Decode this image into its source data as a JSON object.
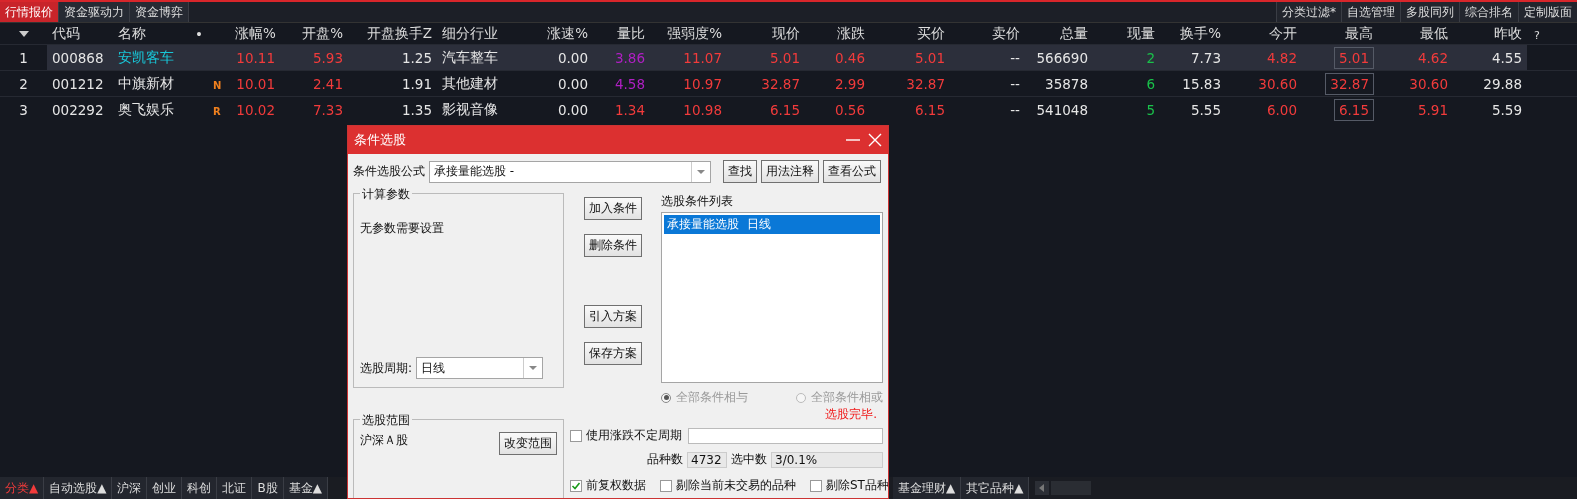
{
  "top_tabs": [
    {
      "label": "行情报价",
      "selected": true
    },
    {
      "label": "资金驱动力",
      "selected": false
    },
    {
      "label": "资金博弈",
      "selected": false
    }
  ],
  "toolbar_buttons": [
    "分类过滤*",
    "自选管理",
    "多股同列",
    "综合排名",
    "定制版面"
  ],
  "table": {
    "columns": [
      "代码",
      "名称",
      "•",
      "涨幅%",
      "开盘%",
      "开盘换手Z",
      "细分行业",
      "涨速%",
      "量比",
      "强弱度%",
      "现价",
      "涨跌",
      "买价",
      "卖价",
      "总量",
      "现量",
      "换手%",
      "今开",
      "最高",
      "最低",
      "昨收"
    ],
    "help_mark": "?",
    "rows": [
      {
        "index": "1",
        "selected": true,
        "cells": [
          {
            "text": "000868",
            "kind": "code"
          },
          {
            "text": "安凯客车",
            "kind": "name"
          },
          {
            "text": "",
            "kind": "flag"
          },
          {
            "text": "10.11",
            "kind": "rise"
          },
          {
            "text": "5.93",
            "kind": "rise"
          },
          {
            "text": "1.25",
            "kind": "plain"
          },
          {
            "text": "汽车整车",
            "kind": "text"
          },
          {
            "text": "0.00",
            "kind": "plain"
          },
          {
            "text": "3.86",
            "kind": "ratio"
          },
          {
            "text": "11.07",
            "kind": "rise"
          },
          {
            "text": "5.01",
            "kind": "rise"
          },
          {
            "text": "0.46",
            "kind": "rise"
          },
          {
            "text": "5.01",
            "kind": "rise"
          },
          {
            "text": "--",
            "kind": "plain"
          },
          {
            "text": "566690",
            "kind": "plain"
          },
          {
            "text": "2",
            "kind": "fall"
          },
          {
            "text": "7.73",
            "kind": "plain"
          },
          {
            "text": "4.82",
            "kind": "rise"
          },
          {
            "text": "5.01",
            "kind": "rise",
            "boxed": true
          },
          {
            "text": "4.62",
            "kind": "rise"
          },
          {
            "text": "4.55",
            "kind": "plain"
          }
        ]
      },
      {
        "index": "2",
        "selected": false,
        "cells": [
          {
            "text": "001212",
            "kind": "code"
          },
          {
            "text": "中旗新材",
            "kind": "name"
          },
          {
            "text": "N",
            "kind": "flag"
          },
          {
            "text": "10.01",
            "kind": "rise"
          },
          {
            "text": "2.41",
            "kind": "rise"
          },
          {
            "text": "1.91",
            "kind": "plain"
          },
          {
            "text": "其他建材",
            "kind": "text"
          },
          {
            "text": "0.00",
            "kind": "plain"
          },
          {
            "text": "4.58",
            "kind": "ratio"
          },
          {
            "text": "10.97",
            "kind": "rise"
          },
          {
            "text": "32.87",
            "kind": "rise"
          },
          {
            "text": "2.99",
            "kind": "rise"
          },
          {
            "text": "32.87",
            "kind": "rise"
          },
          {
            "text": "--",
            "kind": "plain"
          },
          {
            "text": "35878",
            "kind": "plain"
          },
          {
            "text": "6",
            "kind": "fall"
          },
          {
            "text": "15.83",
            "kind": "plain"
          },
          {
            "text": "30.60",
            "kind": "rise"
          },
          {
            "text": "32.87",
            "kind": "rise",
            "boxed": true
          },
          {
            "text": "30.60",
            "kind": "rise"
          },
          {
            "text": "29.88",
            "kind": "plain"
          }
        ]
      },
      {
        "index": "3",
        "selected": false,
        "cells": [
          {
            "text": "002292",
            "kind": "code"
          },
          {
            "text": "奥飞娱乐",
            "kind": "name"
          },
          {
            "text": "R",
            "kind": "flag"
          },
          {
            "text": "10.02",
            "kind": "rise"
          },
          {
            "text": "7.33",
            "kind": "rise"
          },
          {
            "text": "1.35",
            "kind": "plain"
          },
          {
            "text": "影视音像",
            "kind": "text"
          },
          {
            "text": "0.00",
            "kind": "plain"
          },
          {
            "text": "1.34",
            "kind": "rise"
          },
          {
            "text": "10.98",
            "kind": "rise"
          },
          {
            "text": "6.15",
            "kind": "rise"
          },
          {
            "text": "0.56",
            "kind": "rise"
          },
          {
            "text": "6.15",
            "kind": "rise"
          },
          {
            "text": "--",
            "kind": "plain"
          },
          {
            "text": "541048",
            "kind": "plain"
          },
          {
            "text": "5",
            "kind": "fall"
          },
          {
            "text": "5.55",
            "kind": "plain"
          },
          {
            "text": "6.00",
            "kind": "rise"
          },
          {
            "text": "6.15",
            "kind": "rise",
            "boxed": true
          },
          {
            "text": "5.91",
            "kind": "rise"
          },
          {
            "text": "5.59",
            "kind": "plain"
          }
        ]
      }
    ]
  },
  "bottom_tabs_left": [
    {
      "label": "分类▲",
      "selected": true
    },
    {
      "label": "自动选股▲",
      "selected": false
    },
    {
      "label": "沪深",
      "selected": false
    },
    {
      "label": "创业",
      "selected": false
    },
    {
      "label": "科创",
      "selected": false
    },
    {
      "label": "北证",
      "selected": false
    },
    {
      "label": "B股",
      "selected": false
    },
    {
      "label": "基金▲",
      "selected": false
    }
  ],
  "bottom_tabs_right": [
    {
      "label": "基金理财▲",
      "selected": false
    },
    {
      "label": "其它品种▲",
      "selected": false
    }
  ],
  "dialog": {
    "title": "条件选股",
    "formula_label": "条件选股公式",
    "formula_value": "承接量能选股 -",
    "formula_buttons": [
      "查找",
      "用法注释",
      "查看公式"
    ],
    "params_group": "计算参数",
    "params_text": "无参数需要设置",
    "period_label": "选股周期:",
    "period_value": "日线",
    "range_group": "选股范围",
    "range_value": "沪深Ａ股",
    "range_button": "改变范围",
    "action_buttons": [
      "加入条件",
      "删除条件",
      "引入方案",
      "保存方案"
    ],
    "list_label": "选股条件列表",
    "list_items": [
      {
        "label": "承接量能选股  日线",
        "selected": true
      }
    ],
    "logic_options": [
      {
        "label": "全部条件相与",
        "selected": true,
        "disabled": true
      },
      {
        "label": "全部条件相或",
        "selected": false,
        "disabled": true
      }
    ],
    "status": "选股完毕.",
    "variable_period": {
      "label": "使用涨跌不定周期",
      "checked": false
    },
    "count_label": "品种数",
    "count_value": "4732",
    "selected_label": "选中数",
    "selected_value": "3/0.1%",
    "options": [
      {
        "label": "前复权数据",
        "checked": true
      },
      {
        "label": "剔除当前未交易的品种",
        "checked": false
      },
      {
        "label": "剔除ST品种",
        "checked": false
      }
    ]
  }
}
